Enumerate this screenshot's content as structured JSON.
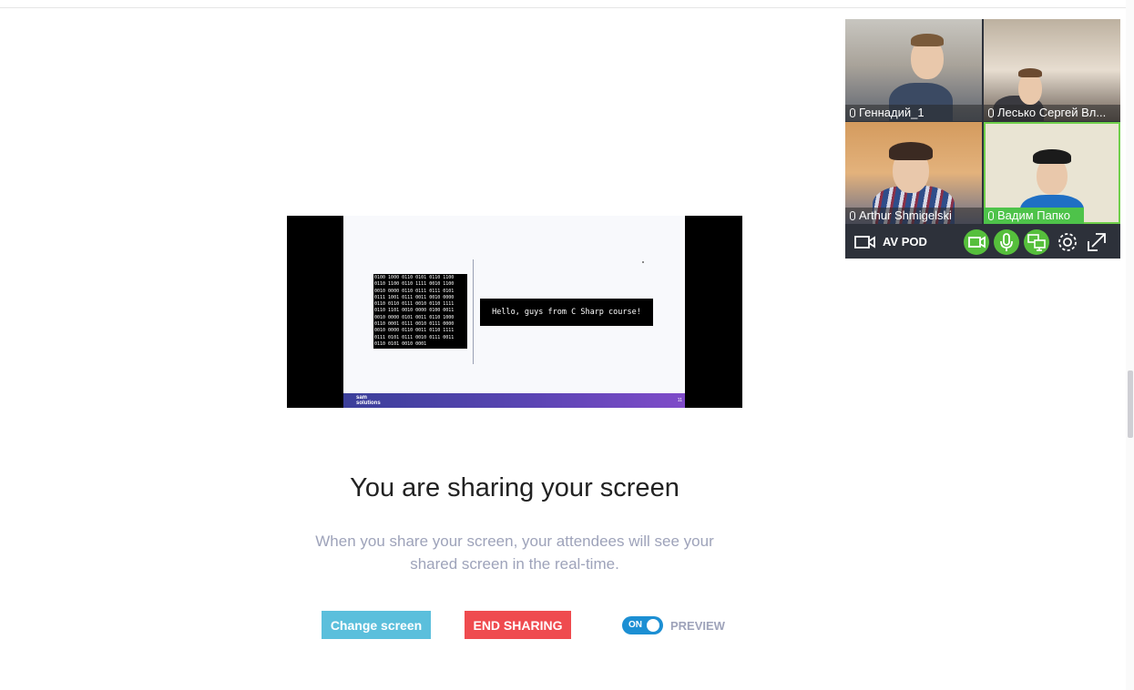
{
  "shared_screen": {
    "code_lines": [
      "0100 1000 0110 0101 0110 1100",
      "0110 1100 0110 1111 0010 1100",
      "0010 0000 0110 0111 0111 0101",
      "0111 1001 0111 0011 0010 0000",
      "0110 0110 0111 0010 0110 1111",
      "0110 1101 0010 0000 0100 0011",
      "0010 0000 0101 0011 0110 1000",
      "0110 0001 0111 0010 0111 0000",
      "0010 0000 0110 0011 0110 1111",
      "0111 0101 0111 0010 0111 0011",
      "0110 0101 0010 0001"
    ],
    "hello_text": "Hello, guys from C Sharp course!",
    "logo_text": "sam\nsolutions",
    "footer_page": "11"
  },
  "sharing": {
    "title": "You are sharing your screen",
    "description": "When you share your screen, your attendees will see your shared screen in the real-time."
  },
  "buttons": {
    "change_screen": "Change screen",
    "end_sharing": "END SHARING"
  },
  "preview_toggle": {
    "state_label": "ON",
    "label": "PREVIEW",
    "on": true
  },
  "video_panel": {
    "participants": [
      {
        "name": "Геннадий_1",
        "speaking": false
      },
      {
        "name": "Лесько Сергей Вл...",
        "speaking": false
      },
      {
        "name": "Arthur Shmigelski",
        "speaking": false
      },
      {
        "name": "Вадим Папко",
        "speaking": true
      }
    ],
    "room_name": "AV POD",
    "icons": [
      "camera-outline-icon",
      "camera-icon",
      "microphone-icon",
      "screen-share-icon",
      "gear-icon",
      "expand-icon"
    ],
    "accent_color": "#56bf3c"
  }
}
